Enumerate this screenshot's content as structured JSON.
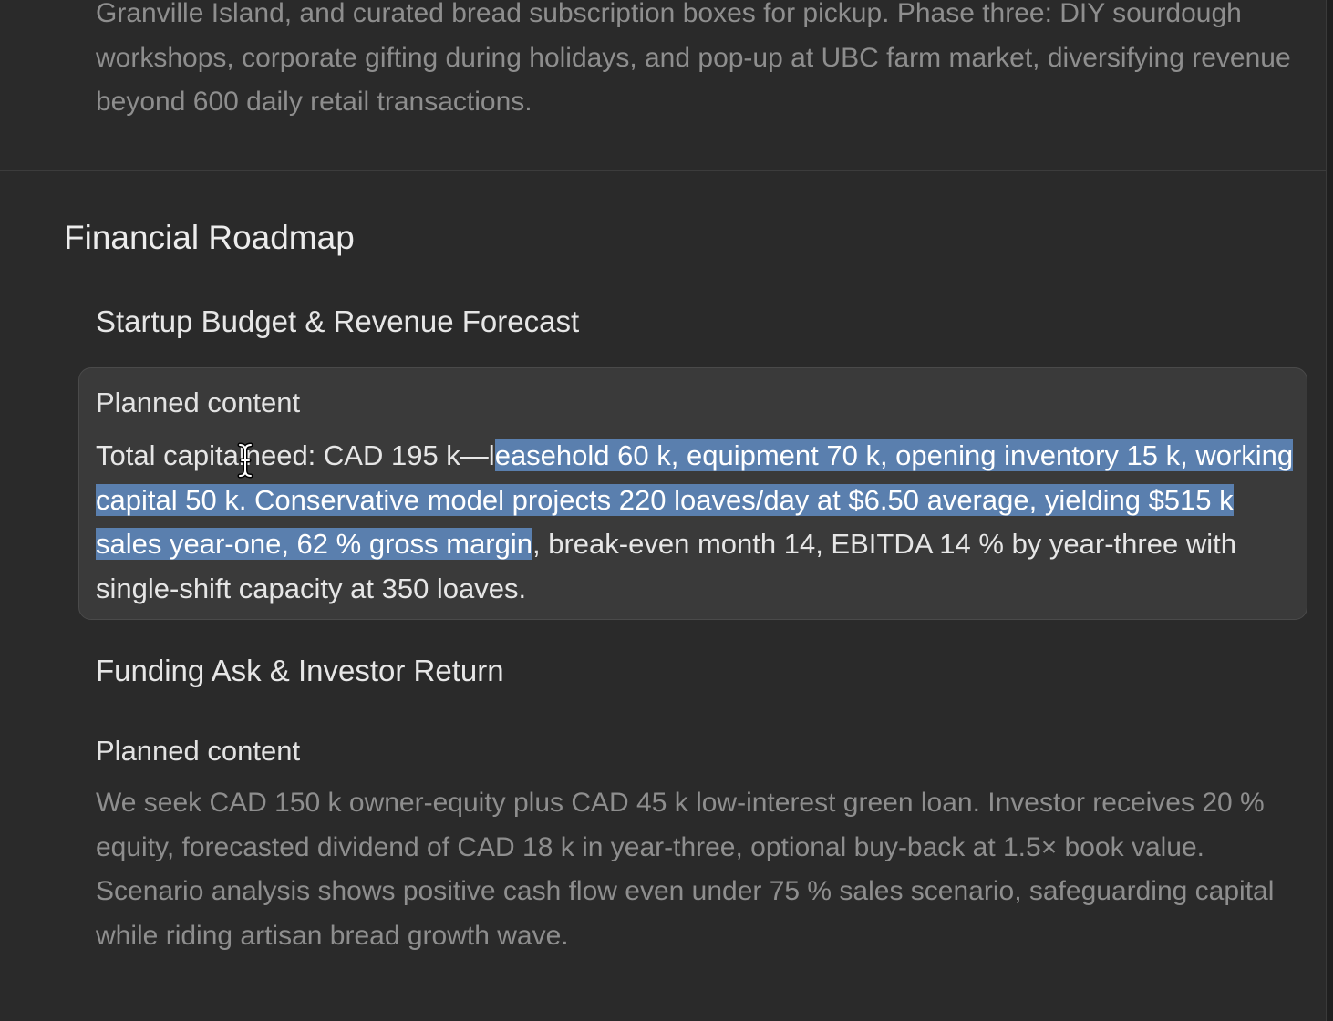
{
  "intro_section": {
    "text": "Granville Island, and curated bread subscription boxes for pickup. Phase three: DIY sourdough workshops, corporate gifting during holidays, and pop-up at UBC farm market, diversifying revenue beyond 600 daily retail transactions."
  },
  "financial_section": {
    "title": "Financial Roadmap",
    "budget": {
      "title": "Startup Budget & Revenue Forecast",
      "label": "Planned content",
      "text_before_cursor": "Total capital",
      "text_after_cursor": "need: CAD 195 k—l",
      "text_selected": "easehold 60 k, equipment 70 k, opening inventory 15 k, working capital 50 k. Conservative model projects 220 loaves/day at $6.50 average, yielding $515 k sales year-one, 62 % gross margin",
      "text_after_selection": ", break-even month 14, EBITDA 14 % by year-three with single-shift capacity at 350 loaves."
    },
    "funding": {
      "title": "Funding Ask & Investor Return",
      "label": "Planned content",
      "text": "We seek CAD 150 k owner-equity plus CAD 45 k low-interest green loan. Investor receives 20 % equity, forecasted dividend of CAD 18 k in year-three, optional buy-back at 1.5× book value. Scenario analysis shows positive cash flow even under 75 % sales scenario, safeguarding capital while riding artisan bread growth wave."
    }
  },
  "colors": {
    "background": "#2a2a2a",
    "card": "#3a3a3a",
    "selection": "#5a7fae",
    "muted_text": "#8e8e8e"
  },
  "icons": {
    "cursor": "text-cursor-icon"
  }
}
